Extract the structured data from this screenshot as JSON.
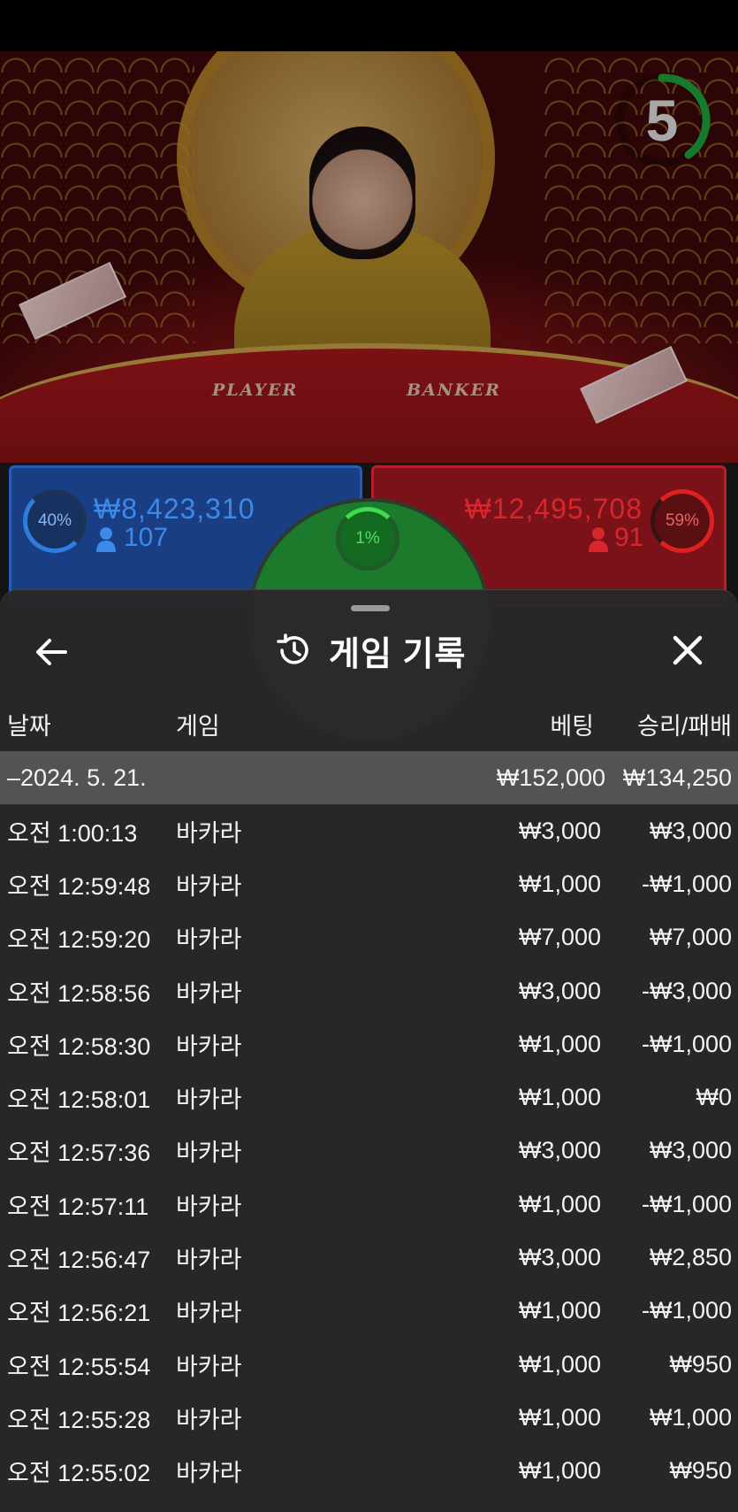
{
  "timer": {
    "value": "5"
  },
  "video": {
    "player_label": "PLAYER",
    "banker_label": "BANKER"
  },
  "bets": {
    "player": {
      "percent": "40%",
      "amount": "₩8,423,310",
      "count": "107"
    },
    "banker": {
      "percent": "59%",
      "amount": "₩12,495,708",
      "count": "91"
    },
    "tie": {
      "percent": "1%"
    }
  },
  "colors": {
    "player": "#2b5bb8",
    "banker": "#b82029",
    "tie": "#1b7a2c",
    "sheet": "#282828"
  },
  "history": {
    "title": "게임 기록",
    "icons": {
      "back": "arrow-left-icon",
      "history": "history-clock-icon",
      "close": "close-x-icon"
    },
    "columns": {
      "date": "날짜",
      "game": "게임",
      "bet": "베팅",
      "result": "승리/패배"
    },
    "summary": {
      "date": "–2024. 5. 21.",
      "bet": "₩152,000",
      "result": "₩134,250"
    },
    "rows": [
      {
        "time": "오전 1:00:13",
        "game": "바카라",
        "bet": "₩3,000",
        "result": "₩3,000"
      },
      {
        "time": "오전 12:59:48",
        "game": "바카라",
        "bet": "₩1,000",
        "result": "-₩1,000"
      },
      {
        "time": "오전 12:59:20",
        "game": "바카라",
        "bet": "₩7,000",
        "result": "₩7,000"
      },
      {
        "time": "오전 12:58:56",
        "game": "바카라",
        "bet": "₩3,000",
        "result": "-₩3,000"
      },
      {
        "time": "오전 12:58:30",
        "game": "바카라",
        "bet": "₩1,000",
        "result": "-₩1,000"
      },
      {
        "time": "오전 12:58:01",
        "game": "바카라",
        "bet": "₩1,000",
        "result": "₩0"
      },
      {
        "time": "오전 12:57:36",
        "game": "바카라",
        "bet": "₩3,000",
        "result": "₩3,000"
      },
      {
        "time": "오전 12:57:11",
        "game": "바카라",
        "bet": "₩1,000",
        "result": "-₩1,000"
      },
      {
        "time": "오전 12:56:47",
        "game": "바카라",
        "bet": "₩3,000",
        "result": "₩2,850"
      },
      {
        "time": "오전 12:56:21",
        "game": "바카라",
        "bet": "₩1,000",
        "result": "-₩1,000"
      },
      {
        "time": "오전 12:55:54",
        "game": "바카라",
        "bet": "₩1,000",
        "result": "₩950"
      },
      {
        "time": "오전 12:55:28",
        "game": "바카라",
        "bet": "₩1,000",
        "result": "₩1,000"
      },
      {
        "time": "오전 12:55:02",
        "game": "바카라",
        "bet": "₩1,000",
        "result": "₩950"
      }
    ]
  }
}
